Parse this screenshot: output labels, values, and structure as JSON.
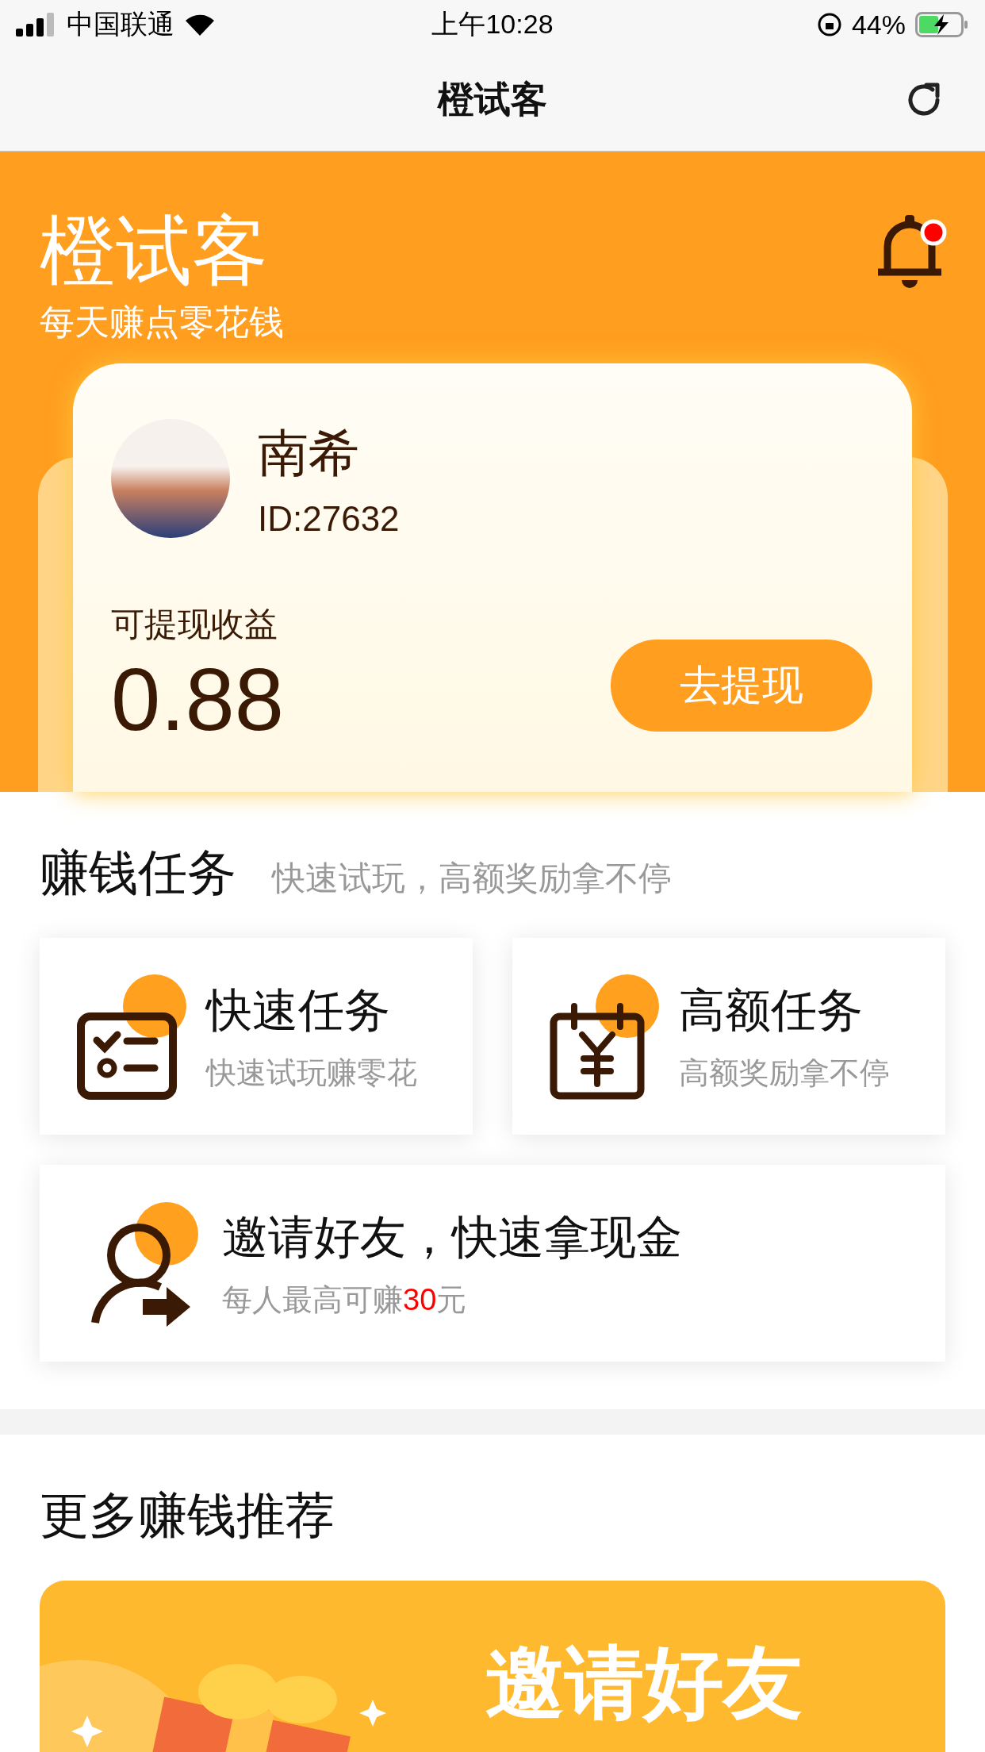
{
  "status_bar": {
    "carrier": "中国联通",
    "time": "上午10:28",
    "battery": "44%"
  },
  "nav_bar": {
    "title": "橙试客"
  },
  "hero": {
    "title": "橙试客",
    "subtitle": "每天赚点零花钱",
    "notification_dot": true
  },
  "profile_card": {
    "name": "南希",
    "id": "ID:27632",
    "balance_label": "可提现收益",
    "balance": "0.88",
    "withdraw_button": "去提现"
  },
  "tasks": {
    "title": "赚钱任务",
    "subtitle": "快速试玩，高额奖励拿不停",
    "items": [
      {
        "kind": "checklist",
        "title": "快速任务",
        "subtitle": "快速试玩赚零花"
      },
      {
        "kind": "calendar",
        "title": "高额任务",
        "subtitle": "高额奖励拿不停"
      }
    ],
    "invite": {
      "title": "邀请好友，快速拿现金",
      "subtitle": "每人最高可赚**30**元"
    }
  },
  "more": {
    "title": "更多赚钱推荐",
    "banner_title": "邀请好友"
  }
}
